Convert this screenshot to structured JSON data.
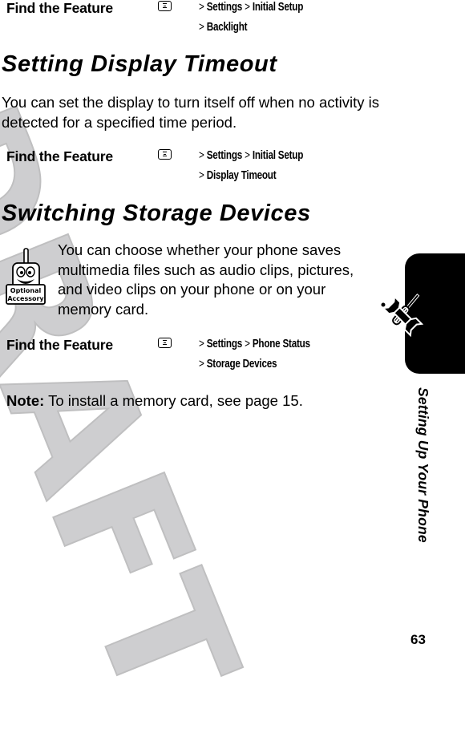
{
  "watermark": "DRAFT",
  "sections": {
    "backlight_feature": {
      "label": "Find the Feature",
      "icon": "menu-key-icon",
      "path": [
        "Settings",
        "Initial Setup",
        "Backlight"
      ]
    },
    "display_timeout": {
      "heading": "Setting Display Timeout",
      "body": "You can set the display to turn itself off when no activity is detected for a specified time period.",
      "feature": {
        "label": "Find the Feature",
        "icon": "menu-key-icon",
        "path": [
          "Settings",
          "Initial Setup",
          "Display Timeout"
        ]
      }
    },
    "storage_devices": {
      "heading": "Switching Storage Devices",
      "accessory_icon": {
        "name": "optional-accessory-icon",
        "line1": "Optional",
        "line2": "Accessory"
      },
      "body": "You can choose whether your phone saves multimedia files such as audio clips, pictures, and video clips on your phone or on your memory card.",
      "feature": {
        "label": "Find the Feature",
        "icon": "menu-key-icon",
        "path": [
          "Settings",
          "Phone Status",
          "Storage Devices"
        ]
      },
      "note_label": "Note:",
      "note_text": " To install a memory card, see page 15."
    }
  },
  "side_tab": {
    "icon": "tools-icon",
    "title": "Setting Up Your Phone"
  },
  "page_number": "63",
  "symbols": {
    "gt": ">"
  }
}
